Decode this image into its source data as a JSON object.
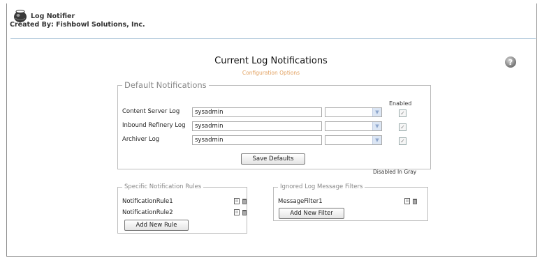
{
  "app": {
    "title": "Log Notifier",
    "credit": "Created By: Fishbowl Solutions, Inc.",
    "logo_icon": "fishbowl-logo-icon",
    "help_icon": "help-icon"
  },
  "page": {
    "title": "Current Log Notifications",
    "config_link": "Configuration Options"
  },
  "defaults": {
    "legend": "Default Notifications",
    "enabled_header": "Enabled",
    "rows": [
      {
        "label": "Content Server Log",
        "user": "sysadmin",
        "enabled": true
      },
      {
        "label": "Inbound Refinery Log",
        "user": "sysadmin",
        "enabled": true
      },
      {
        "label": "Archiver Log",
        "user": "sysadmin",
        "enabled": true
      }
    ],
    "save_label": "Save Defaults",
    "disabled_note": "Disabled In Gray"
  },
  "rules": {
    "legend": "Specific Notification Rules",
    "items": [
      "NotificationRule1",
      "NotificationRule2"
    ],
    "add_label": "Add New Rule"
  },
  "filters": {
    "legend": "Ignored Log Message Filters",
    "items": [
      "MessageFilter1"
    ],
    "add_label": "Add New Filter"
  },
  "colors": {
    "accent_link": "#e2a160",
    "header_rule": "#a7c1d6",
    "fieldset_border": "#bcbcbc"
  }
}
